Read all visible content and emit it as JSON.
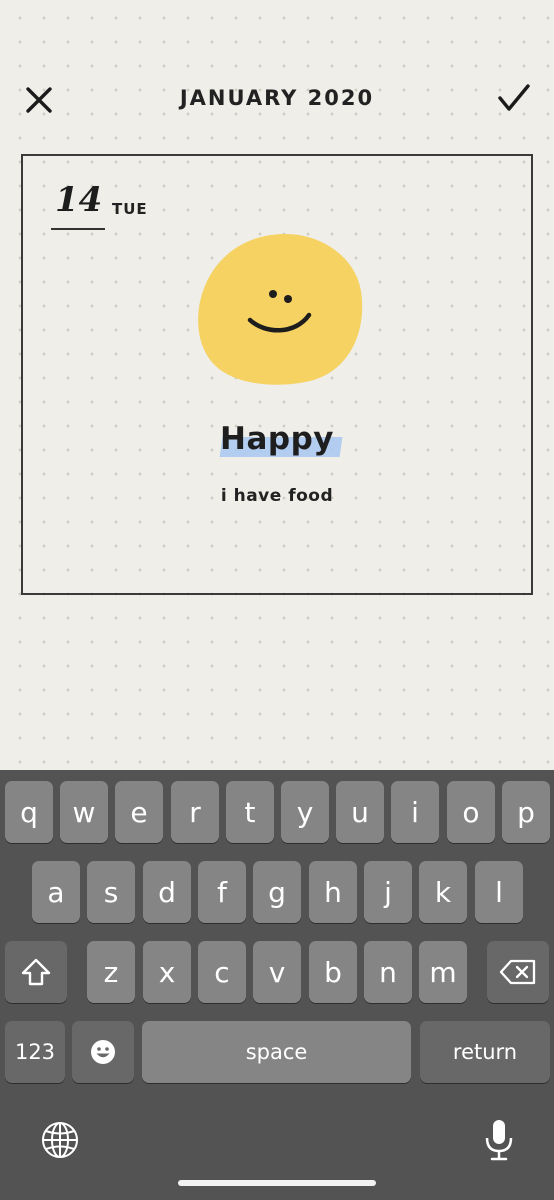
{
  "header": {
    "title": "JANUARY 2020"
  },
  "entry": {
    "day_number": "14",
    "day_name": "TUE",
    "mood": "Happy",
    "note": "i have food"
  },
  "colors": {
    "face": "#f6d262",
    "highlight": "#a7c7f0",
    "keyboard_bg": "#535353",
    "key_bg": "#858585",
    "key_dark_bg": "#686868"
  },
  "keyboard": {
    "row1": [
      "q",
      "w",
      "e",
      "r",
      "t",
      "y",
      "u",
      "i",
      "o",
      "p"
    ],
    "row2": [
      "a",
      "s",
      "d",
      "f",
      "g",
      "h",
      "j",
      "k",
      "l"
    ],
    "row3": [
      "z",
      "x",
      "c",
      "v",
      "b",
      "n",
      "m"
    ],
    "numbers_label": "123",
    "space_label": "space",
    "return_label": "return",
    "icons": [
      "shift-icon",
      "backspace-icon",
      "emoji-icon",
      "globe-icon",
      "microphone-icon"
    ]
  }
}
